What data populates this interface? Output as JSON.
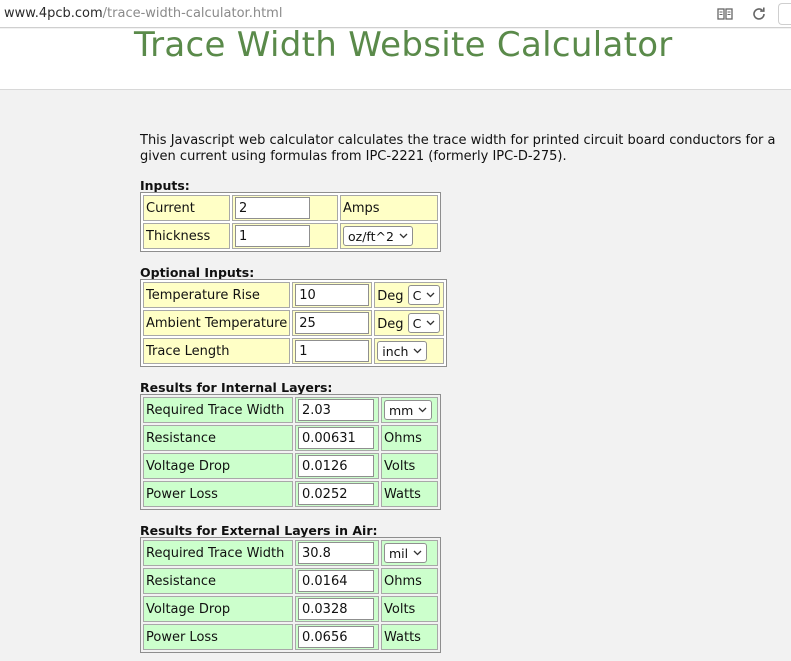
{
  "browser": {
    "url_host": "www.4pcb.com",
    "url_path": "/trace-width-calculator.html"
  },
  "site": {
    "title": "Trace Width Website Calculator"
  },
  "intro": "This Javascript web calculator calculates the trace width for printed circuit board conductors for a given current using formulas from IPC-2221 (formerly IPC-D-275).",
  "inputs": {
    "title": "Inputs:",
    "rows": [
      {
        "label": "Current",
        "value": "2",
        "unit": "Amps"
      },
      {
        "label": "Thickness",
        "value": "1",
        "unit_select": "oz/ft^2"
      }
    ]
  },
  "optional": {
    "title": "Optional Inputs:",
    "rows": [
      {
        "label": "Temperature Rise",
        "value": "10",
        "unit_prefix": "Deg",
        "unit_select": "C"
      },
      {
        "label": "Ambient Temperature",
        "value": "25",
        "unit_prefix": "Deg",
        "unit_select": "C"
      },
      {
        "label": "Trace Length",
        "value": "1",
        "unit_select": "inch"
      }
    ]
  },
  "internal": {
    "title": "Results for Internal Layers:",
    "rows": [
      {
        "label": "Required Trace Width",
        "value": "2.03",
        "unit_select": "mm"
      },
      {
        "label": "Resistance",
        "value": "0.00631",
        "unit": "Ohms"
      },
      {
        "label": "Voltage Drop",
        "value": "0.0126",
        "unit": "Volts"
      },
      {
        "label": "Power Loss",
        "value": "0.0252",
        "unit": "Watts"
      }
    ]
  },
  "external": {
    "title": "Results for External Layers in Air:",
    "rows": [
      {
        "label": "Required Trace Width",
        "value": "30.8",
        "unit_select": "mil"
      },
      {
        "label": "Resistance",
        "value": "0.0164",
        "unit": "Ohms"
      },
      {
        "label": "Voltage Drop",
        "value": "0.0328",
        "unit": "Volts"
      },
      {
        "label": "Power Loss",
        "value": "0.0656",
        "unit": "Watts"
      }
    ]
  },
  "colors": {
    "title_green": "#5a8a4a",
    "input_bg": "#ffffc6",
    "result_bg": "#ccffcc"
  }
}
